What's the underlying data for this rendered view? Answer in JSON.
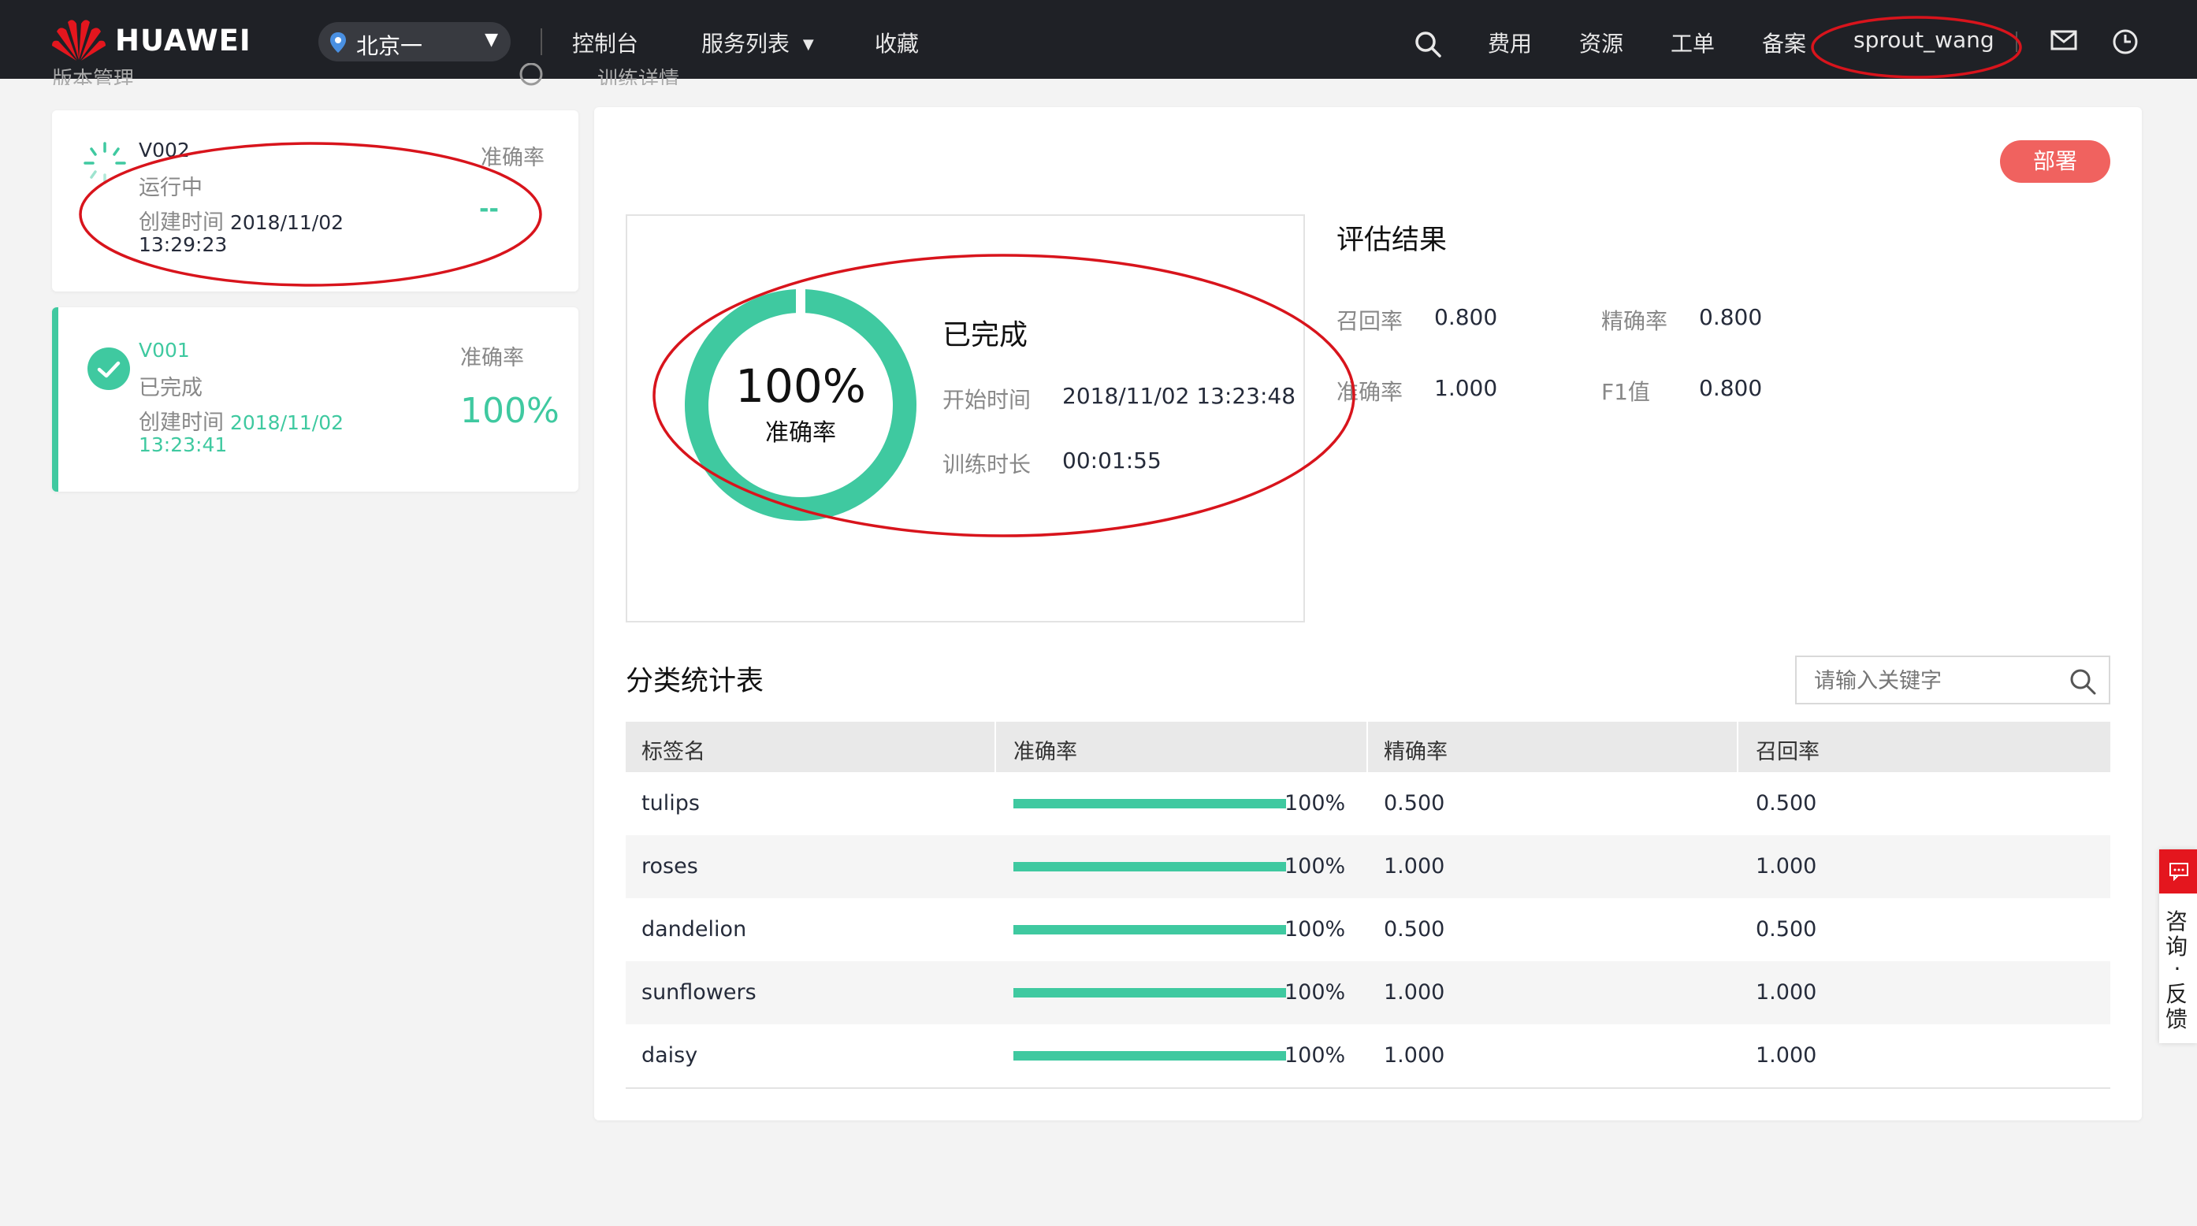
{
  "nav": {
    "brand": "HUAWEI",
    "region": "北京一",
    "items": [
      "控制台",
      "服务列表",
      "收藏"
    ],
    "right_items": [
      "费用",
      "资源",
      "工单",
      "备案"
    ],
    "username": "sprout_wang"
  },
  "faded_header": {
    "left": "版本管理",
    "right": "训练详情"
  },
  "versions": [
    {
      "name": "V002",
      "status": "运行中",
      "created_label": "创建时间",
      "created_date": "2018/11/02",
      "created_time": "13:29:23",
      "metric_label": "准确率",
      "metric_value": "--"
    },
    {
      "name": "V001",
      "status": "已完成",
      "created_label": "创建时间",
      "created_date": "2018/11/02",
      "created_time": "13:23:41",
      "metric_label": "准确率",
      "metric_value": "100%"
    }
  ],
  "detail": {
    "deploy_button": "部署",
    "donut_value": "100%",
    "donut_fraction": 1.0,
    "donut_label": "准确率",
    "status": "已完成",
    "start_label": "开始时间",
    "start_value": "2018/11/02 13:23:48",
    "duration_label": "训练时长",
    "duration_value": "00:01:55",
    "eval_title": "评估结果",
    "eval": {
      "recall_label": "召回率",
      "recall_value": "0.800",
      "precision_label": "精确率",
      "precision_value": "0.800",
      "accuracy_label": "准确率",
      "accuracy_value": "1.000",
      "f1_label": "F1值",
      "f1_value": "0.800"
    }
  },
  "table": {
    "title": "分类统计表",
    "search_placeholder": "请输入关键字",
    "columns": [
      "标签名",
      "准确率",
      "精确率",
      "召回率"
    ],
    "rows": [
      {
        "label": "tulips",
        "accuracy": "100%",
        "accuracy_fraction": 1.0,
        "precision": "0.500",
        "recall": "0.500"
      },
      {
        "label": "roses",
        "accuracy": "100%",
        "accuracy_fraction": 1.0,
        "precision": "1.000",
        "recall": "1.000"
      },
      {
        "label": "dandelion",
        "accuracy": "100%",
        "accuracy_fraction": 1.0,
        "precision": "0.500",
        "recall": "0.500"
      },
      {
        "label": "sunflowers",
        "accuracy": "100%",
        "accuracy_fraction": 1.0,
        "precision": "1.000",
        "recall": "1.000"
      },
      {
        "label": "daisy",
        "accuracy": "100%",
        "accuracy_fraction": 1.0,
        "precision": "1.000",
        "recall": "1.000"
      }
    ]
  },
  "feedback": {
    "label_top": "咨询",
    "dot": "·",
    "label_bottom": "反馈"
  },
  "colors": {
    "accent_green": "#3fc9a0",
    "deploy_red": "#f0625f",
    "annotation_red": "#d8141c",
    "nav_bg": "#1f2126"
  }
}
